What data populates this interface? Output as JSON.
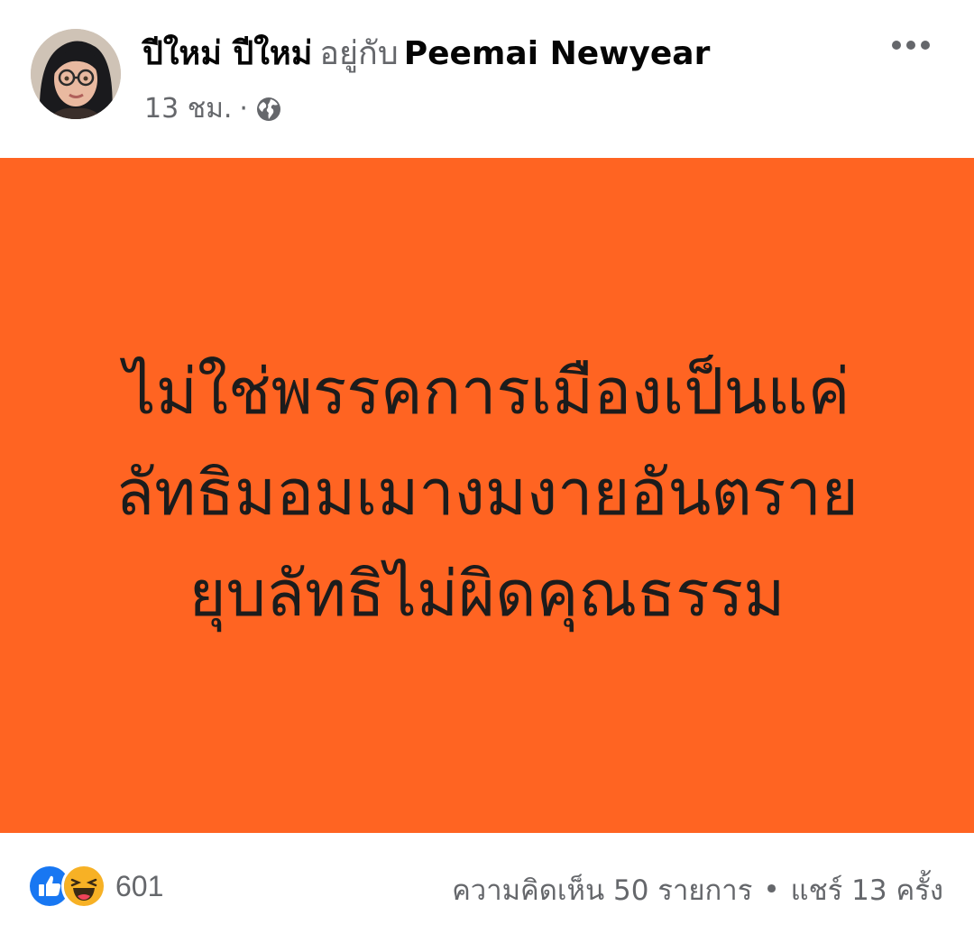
{
  "post": {
    "author": "ปีใหม่ ปีใหม่",
    "with_word": "อยู่กับ",
    "tagged_person": "Peemai Newyear",
    "time": "13 ชม.",
    "separator": "·",
    "privacy_icon": "globe-icon",
    "menu_icon": "more-options-icon"
  },
  "card": {
    "background": "#ff6422",
    "lines": [
      "ไม่ใช่พรรคการเมืองเป็นแค่",
      "ลัทธิมอมเมางมงายอันตราย",
      "ยุบลัทธิไม่ผิดคุณธรรม"
    ]
  },
  "footer": {
    "reaction_icons": [
      "like-icon",
      "haha-icon"
    ],
    "reaction_count": "601",
    "comments": "ความคิดเห็น 50 รายการ",
    "bullet": "•",
    "shares": "แชร์ 13 ครั้ง"
  },
  "colors": {
    "accent_orange": "#ff6422",
    "secondary_text": "#65676b",
    "like_blue": "#1877f2",
    "haha_yellow": "#f7b125"
  }
}
